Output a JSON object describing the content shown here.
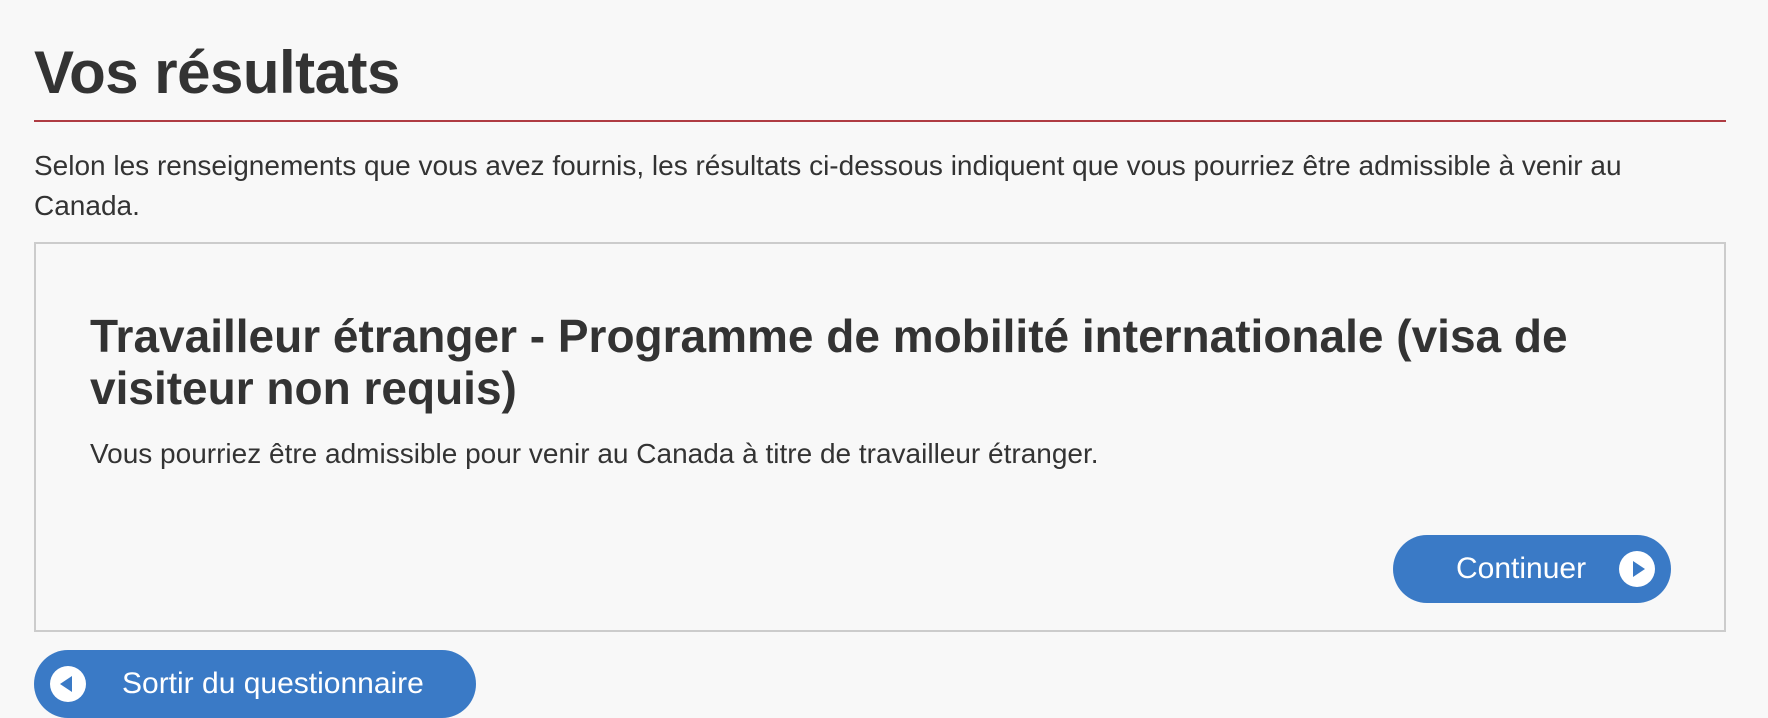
{
  "header": {
    "title": "Vos résultats"
  },
  "intro": {
    "text": "Selon les renseignements que vous avez fournis, les résultats ci-dessous indiquent que vous pourriez être admissible à venir au Canada."
  },
  "result": {
    "title": "Travailleur étranger - Programme de mobilité internationale  (visa de visiteur non requis)",
    "description": "Vous pourriez être admissible pour venir au Canada à titre de travailleur étranger.",
    "continue_label": "Continuer",
    "continue_icon": "play-circle-icon"
  },
  "footer": {
    "exit_label": "Sortir du questionnaire",
    "exit_icon": "back-circle-icon"
  },
  "colors": {
    "accent_rule": "#af3c43",
    "button": "#3a7ac6",
    "text": "#333333",
    "card_border": "#cccccc"
  }
}
